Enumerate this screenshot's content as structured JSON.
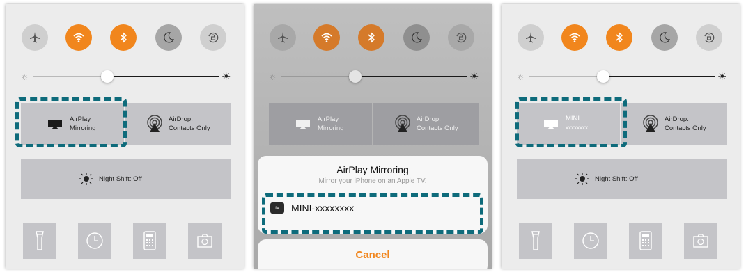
{
  "panels": [
    {
      "tiles": {
        "airplay_line1": "AirPlay",
        "airplay_line2": "Mirroring",
        "airdrop_line1": "AirDrop:",
        "airdrop_line2": "Contacts Only",
        "night_shift": "Night Shift: Off"
      }
    },
    {
      "tiles": {
        "airplay_line1": "AirPlay",
        "airplay_line2": "Mirroring",
        "airdrop_line1": "AirDrop:",
        "airdrop_line2": "Contacts Only"
      },
      "sheet": {
        "title": "AirPlay Mirroring",
        "subtitle": "Mirror your iPhone on an Apple TV.",
        "device_badge": "tv",
        "device_name": "MINI-xxxxxxxx",
        "cancel": "Cancel"
      }
    },
    {
      "tiles": {
        "airplay_line1": "MINI",
        "airplay_line2": "xxxxxxxx",
        "airdrop_line1": "AirDrop:",
        "airdrop_line2": "Contacts Only",
        "night_shift": "Night Shift: Off"
      }
    }
  ],
  "icons": [
    "airplane-icon",
    "wifi-icon",
    "bluetooth-icon",
    "moon-icon",
    "rotation-lock-icon",
    "flashlight-icon",
    "clock-icon",
    "calculator-icon",
    "camera-icon",
    "airplay-icon",
    "airdrop-icon",
    "night-shift-icon"
  ],
  "colors": {
    "accent": "#f1861d",
    "highlight": "#0e6b7b",
    "tile": "#c4c4c8",
    "panel": "#ececec"
  }
}
